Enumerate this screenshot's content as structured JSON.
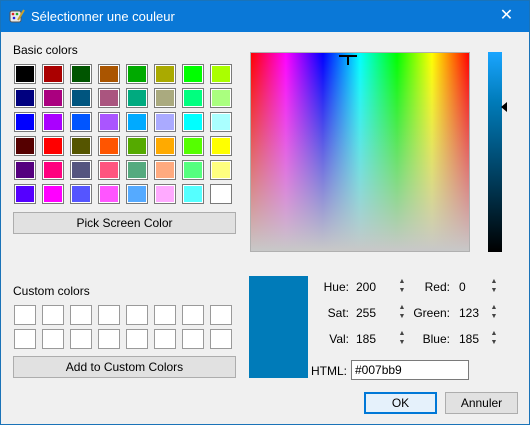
{
  "window": {
    "title": "Sélectionner une couleur",
    "close_icon": "close-icon"
  },
  "basic_colors": {
    "label": "Basic colors",
    "swatches": [
      "#000000",
      "#aa0000",
      "#005500",
      "#aa5500",
      "#00aa00",
      "#aaaa00",
      "#00ff00",
      "#aaff00",
      "#00007f",
      "#aa007f",
      "#00557f",
      "#aa557f",
      "#00aa7f",
      "#aaaa7f",
      "#00ff7f",
      "#aaff7f",
      "#0000ff",
      "#aa00ff",
      "#0055ff",
      "#aa55ff",
      "#00aaff",
      "#aaaaff",
      "#00ffff",
      "#aaffff",
      "#550000",
      "#ff0000",
      "#555500",
      "#ff5500",
      "#55aa00",
      "#ffaa00",
      "#55ff00",
      "#ffff00",
      "#55007f",
      "#ff007f",
      "#55557f",
      "#ff557f",
      "#55aa7f",
      "#ffaa7f",
      "#55ff7f",
      "#ffff7f",
      "#5500ff",
      "#ff00ff",
      "#5555ff",
      "#ff55ff",
      "#55aaff",
      "#ffaaff",
      "#55ffff",
      "#ffffff"
    ]
  },
  "pick_screen_label": "Pick Screen Color",
  "custom_colors": {
    "label": "Custom colors",
    "count": 16
  },
  "add_custom_label": "Add to Custom Colors",
  "current_color": "#007bb9",
  "fields": {
    "hue": {
      "label": "Hue:",
      "value": "200"
    },
    "sat": {
      "label": "Sat:",
      "value": "255"
    },
    "val": {
      "label": "Val:",
      "value": "185"
    },
    "red": {
      "label": "Red:",
      "value": "0"
    },
    "green": {
      "label": "Green:",
      "value": "123"
    },
    "blue": {
      "label": "Blue:",
      "value": "185"
    }
  },
  "html": {
    "label": "HTML:",
    "value": "#007bb9"
  },
  "buttons": {
    "ok": "OK",
    "cancel": "Annuler"
  }
}
